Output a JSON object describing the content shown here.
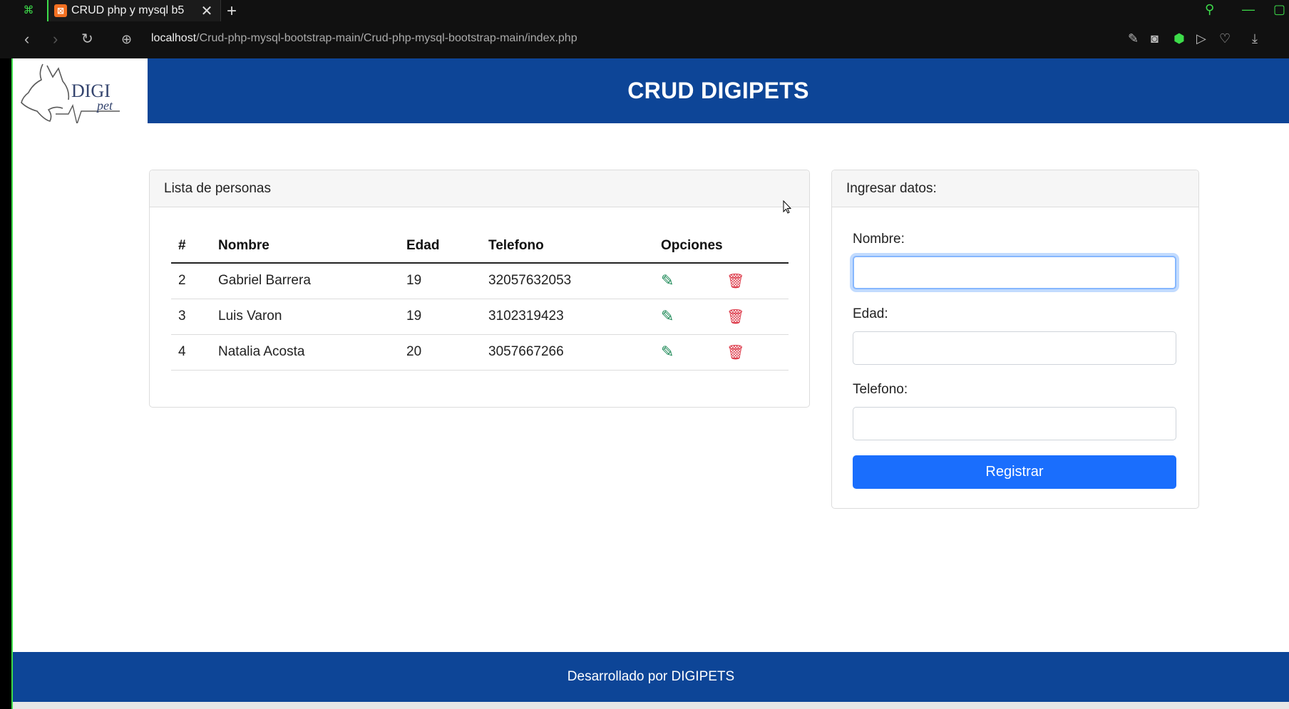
{
  "browser": {
    "tab_title": "CRUD php y mysql b5",
    "tab_close": "✕",
    "new_tab": "+",
    "url_host": "localhost",
    "url_path": "/Crud-php-mysql-bootstrap-main/Crud-php-mysql-bootstrap-main/index.php"
  },
  "header": {
    "logo_text": "DIGI",
    "logo_subtext": "pet",
    "title": "CRUD DIGIPETS"
  },
  "list_card": {
    "title": "Lista de personas",
    "columns": [
      "#",
      "Nombre",
      "Edad",
      "Telefono",
      "Opciones"
    ],
    "rows": [
      {
        "id": "2",
        "nombre": "Gabriel Barrera",
        "edad": "19",
        "telefono": "32057632053"
      },
      {
        "id": "3",
        "nombre": "Luis Varon",
        "edad": "19",
        "telefono": "3102319423"
      },
      {
        "id": "4",
        "nombre": "Natalia Acosta",
        "edad": "20",
        "telefono": "3057667266"
      }
    ]
  },
  "form_card": {
    "title": "Ingresar datos:",
    "nombre_label": "Nombre:",
    "nombre_value": "",
    "edad_label": "Edad:",
    "edad_value": "",
    "telefono_label": "Telefono:",
    "telefono_value": "",
    "submit_label": "Registrar"
  },
  "footer": {
    "text": "Desarrollado por DIGIPETS"
  },
  "colors": {
    "brand_blue": "#0d4597",
    "primary": "#1a6efd",
    "edit": "#198754",
    "delete": "#dc3545",
    "accent_green": "#3ddc4a"
  }
}
